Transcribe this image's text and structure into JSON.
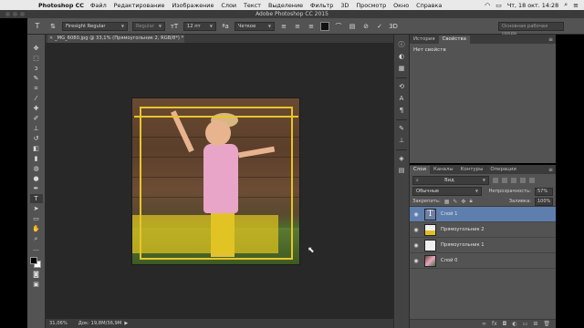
{
  "menubar": {
    "app_name": "Photoshop CC",
    "items": [
      "Файл",
      "Редактирование",
      "Изображение",
      "Слои",
      "Текст",
      "Выделение",
      "Фильтр",
      "3D",
      "Просмотр",
      "Окно",
      "Справка"
    ],
    "clock": "Чт, 18 окт.  14:28"
  },
  "window": {
    "title": "Adobe Photoshop CC 2015"
  },
  "options_bar": {
    "font_family": "Firesight Regular",
    "font_style": "Regular",
    "font_size": "12 пт",
    "antialias": "Четкое",
    "workspace": "Основная рабочая среда"
  },
  "document": {
    "tab_label": "_MG_6080.jpg @ 33,1% (Прямоугольник 2, RGB/8*) *",
    "zoom": "31,06%",
    "doc_size": "Док: 19,8M/36,9M"
  },
  "properties_panel": {
    "tabs": [
      "История",
      "Свойства"
    ],
    "active_tab": "Свойства",
    "header": "Нет свойств"
  },
  "layers_panel": {
    "tabs": [
      "Слои",
      "Каналы",
      "Контуры",
      "Операции"
    ],
    "active_tab": "Слои",
    "filter_kind": "Вид",
    "blend_mode": "Обычные",
    "opacity_label": "Непрозрачность:",
    "opacity": "57%",
    "lock_label": "Закрепить:",
    "fill_label": "Заливка:",
    "fill": "100%",
    "layers": [
      {
        "name": "Слой 1",
        "type": "text",
        "active": true
      },
      {
        "name": "Прямоугольник 2",
        "type": "shape-y",
        "active": false
      },
      {
        "name": "Прямоугольник 1",
        "type": "shape-w",
        "active": false
      },
      {
        "name": "Слой 0",
        "type": "photo",
        "active": false
      }
    ]
  },
  "colors": {
    "accent": "#5e7fae",
    "selection_frame": "#e7c52a"
  }
}
